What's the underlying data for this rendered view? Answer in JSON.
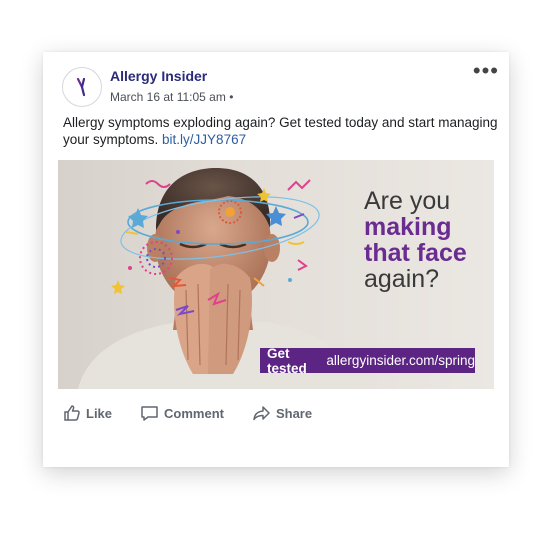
{
  "post": {
    "page_name": "Allergy Insider",
    "timestamp": "March 16 at 11:05 am",
    "meta_separator": "•",
    "text": "Allergy symptoms exploding again? Get tested today and start managing your symptoms.",
    "link": "bit.ly/JJY8767",
    "more_icon": "more-options-icon"
  },
  "ad": {
    "headline_line1": "Are you",
    "headline_line2": "making",
    "headline_line3": "that face",
    "headline_line4": "again?",
    "cta_button": "Get tested",
    "cta_url": "allergyinsider.com/spring",
    "accent_color": "#6a2c91",
    "cta_bg_color": "#5c2583"
  },
  "actions": {
    "like": "Like",
    "comment": "Comment",
    "share": "Share"
  },
  "colors": {
    "page_name": "#2b2a7a",
    "link": "#2d5e9f",
    "action_text": "#606770"
  }
}
